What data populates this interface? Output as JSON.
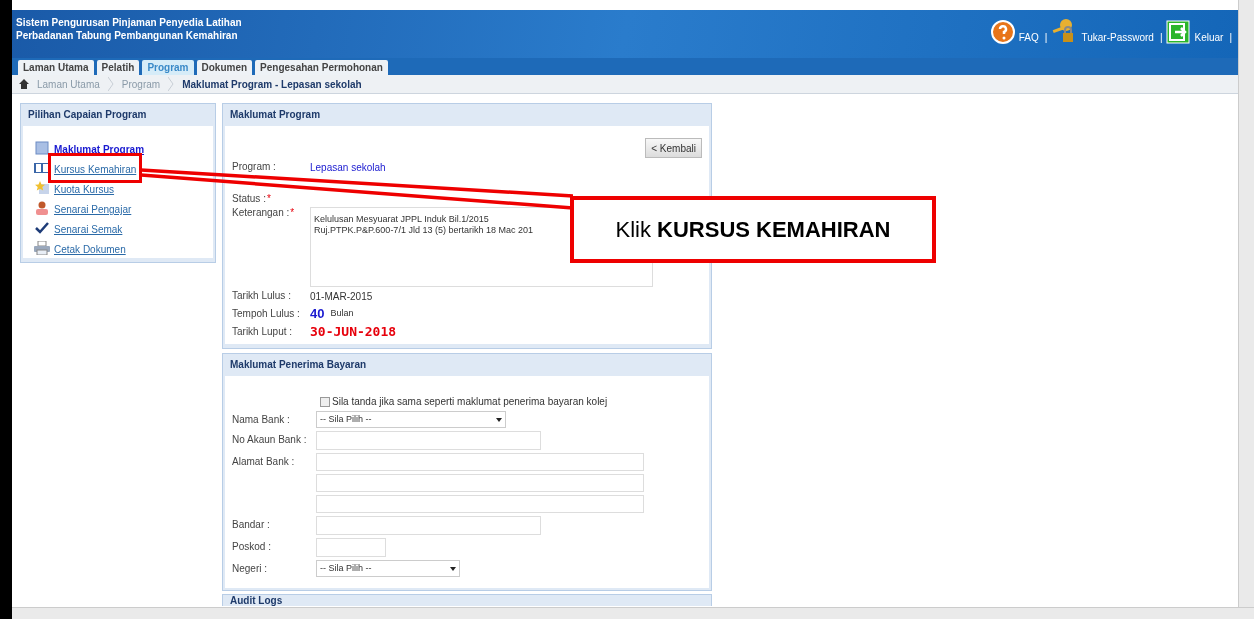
{
  "header": {
    "title_lines": [
      "Sistem Pengurusan Pinjaman Penyedia Latihan",
      "Perbadanan Tabung Pembangunan Kemahiran"
    ],
    "links": [
      {
        "kind": "help",
        "label": "FAQ"
      },
      {
        "kind": "key",
        "label": "Tukar-Password"
      },
      {
        "kind": "exit",
        "label": "Keluar"
      }
    ],
    "separator": "|"
  },
  "tabs": [
    {
      "label": "Laman Utama",
      "selected": false
    },
    {
      "label": "Pelatih",
      "selected": false
    },
    {
      "label": "Program",
      "selected": true
    },
    {
      "label": "Dokumen",
      "selected": false
    },
    {
      "label": "Pengesahan Permohonan",
      "selected": false
    }
  ],
  "breadcrumb": [
    "Laman Utama",
    "Program"
  ],
  "page_title": "Maklumat Program - Lepasan sekolah",
  "sidebar": {
    "title": "Pilihan Capaian Program",
    "items": [
      {
        "kind": "page",
        "label": "Maklumat Program",
        "selected": true,
        "highlighted": false
      },
      {
        "kind": "book",
        "label": "Kursus Kemahiran",
        "selected": false,
        "highlighted": true
      },
      {
        "kind": "star",
        "label": "Kuota Kursus",
        "selected": false,
        "highlighted": false
      },
      {
        "kind": "person",
        "label": "Senarai Pengajar",
        "selected": false,
        "highlighted": false
      },
      {
        "kind": "check",
        "label": "Senarai Semak",
        "selected": false,
        "highlighted": false
      },
      {
        "kind": "printer",
        "label": "Cetak Dokumen",
        "selected": false,
        "highlighted": false
      }
    ]
  },
  "program_panel": {
    "title": "Maklumat Program",
    "back_button": "< Kembali",
    "program_label": "Program :",
    "program_value": "Lepasan sekolah",
    "status_label": "Status :",
    "status_required": "*",
    "keterangan_label": "Keterangan :",
    "keterangan_required": "*",
    "keterangan_value": [
      "Kelulusan Mesyuarat JPPL Induk Bil.1/2015",
      "Ruj.PTPK.P&P.600-7/1 Jld 13 (5) bertarikh 18 Mac 201"
    ],
    "tarikh_lulus_label": "Tarikh Lulus :",
    "tarikh_lulus": "01-MAR-2015",
    "tempoh_label": "Tempoh Lulus :",
    "tempoh_value": "40",
    "tempoh_unit": "Bulan",
    "tarikh_luput_label": "Tarikh Luput :",
    "tarikh_luput": "30-JUN-2018"
  },
  "payee_panel": {
    "title": "Maklumat Penerima Bayaran",
    "same_as_college": {
      "label": "Sila tanda jika sama seperti maklumat penerima bayaran kolej",
      "checked": false
    },
    "fields": [
      {
        "kind": "select",
        "label": "Nama Bank :",
        "value": "-- Sila Pilih --"
      },
      {
        "kind": "text",
        "label": "No Akaun Bank :"
      },
      {
        "kind": "address",
        "label": "Alamat Bank :"
      },
      {
        "kind": "text",
        "label": "Bandar :"
      },
      {
        "kind": "text",
        "label": "Poskod :"
      },
      {
        "kind": "select",
        "label": "Negeri :",
        "value": "-- Sila Pilih --"
      }
    ]
  },
  "audit_panel": {
    "title": "Audit Logs"
  },
  "annotation": {
    "prefix": "Klik ",
    "emphasis": "KURSUS KEMAHIRAN"
  }
}
